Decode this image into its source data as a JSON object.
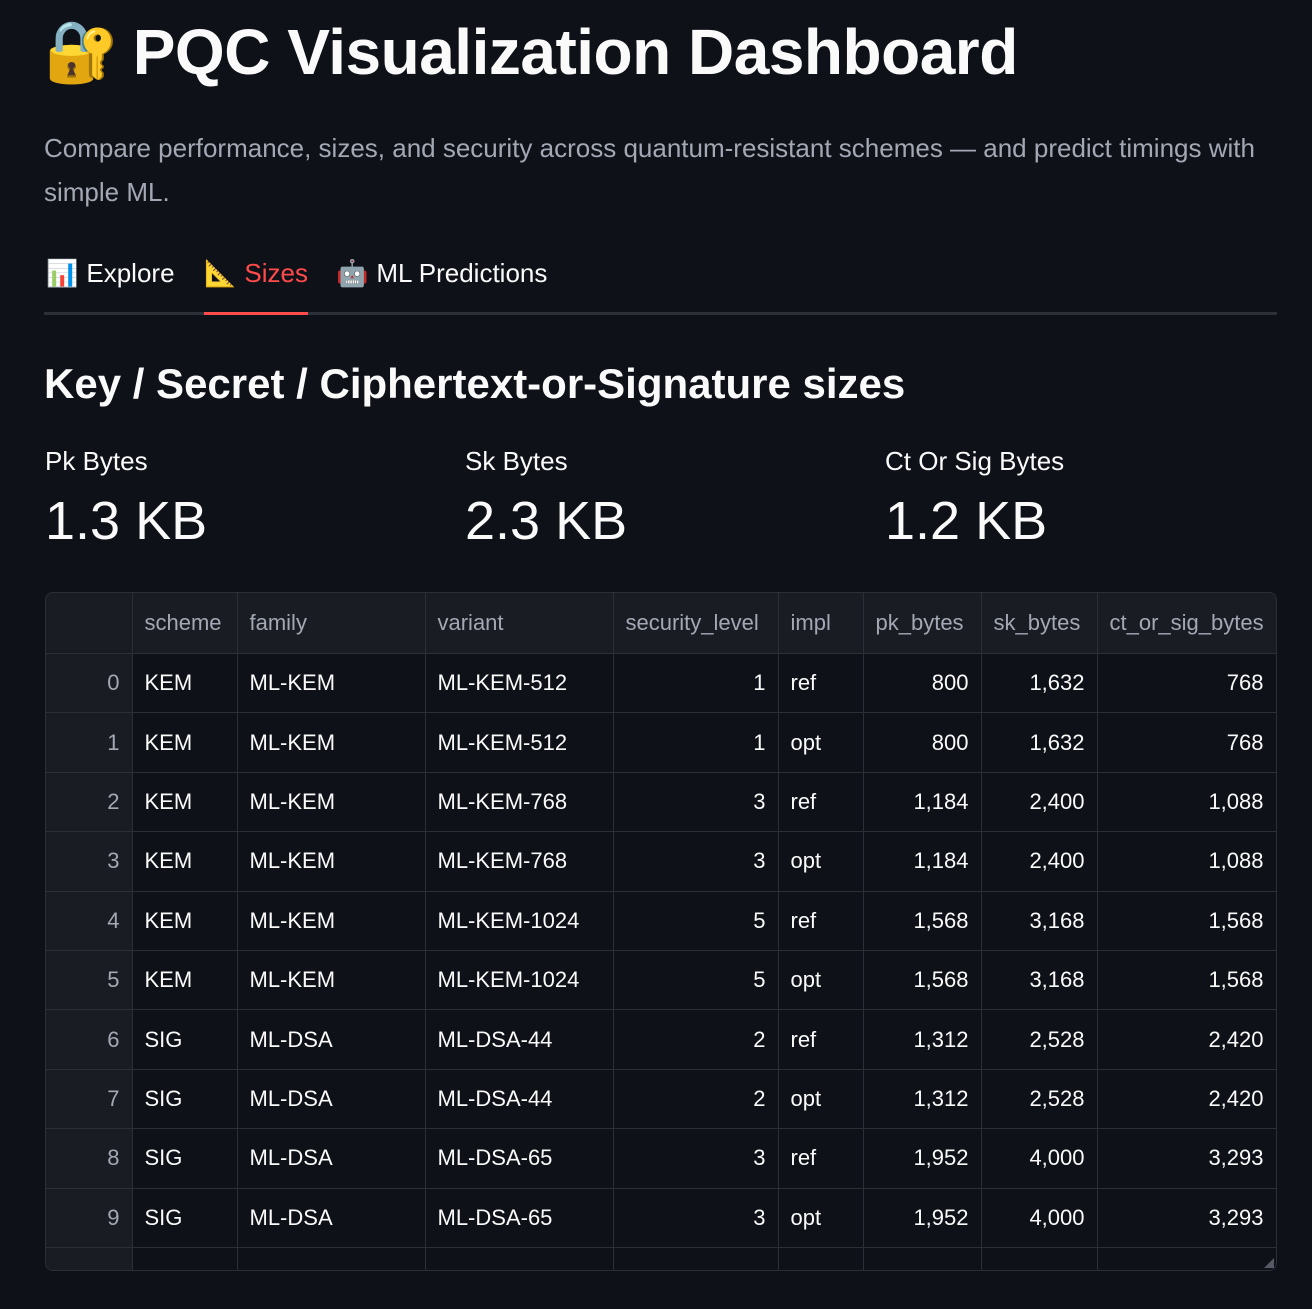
{
  "header": {
    "icon": "🔐",
    "title": "PQC Visualization Dashboard",
    "subtitle": "Compare performance, sizes, and security across quantum-resistant schemes — and predict timings with simple ML."
  },
  "tabs": [
    {
      "icon": "📊",
      "label": "Explore",
      "active": false
    },
    {
      "icon": "📐",
      "label": "Sizes",
      "active": true
    },
    {
      "icon": "🤖",
      "label": "ML Predictions",
      "active": false
    }
  ],
  "section": {
    "title": "Key / Secret / Ciphertext-or-Signature sizes"
  },
  "metrics": [
    {
      "label": "Pk Bytes",
      "value": "1.3 KB"
    },
    {
      "label": "Sk Bytes",
      "value": "2.3 KB"
    },
    {
      "label": "Ct Or Sig Bytes",
      "value": "1.2 KB"
    }
  ],
  "table": {
    "columns": [
      "",
      "scheme",
      "family",
      "variant",
      "security_level",
      "impl",
      "pk_bytes",
      "sk_bytes",
      "ct_or_sig_bytes"
    ],
    "rows": [
      [
        "0",
        "KEM",
        "ML-KEM",
        "ML-KEM-512",
        "1",
        "ref",
        "800",
        "1,632",
        "768"
      ],
      [
        "1",
        "KEM",
        "ML-KEM",
        "ML-KEM-512",
        "1",
        "opt",
        "800",
        "1,632",
        "768"
      ],
      [
        "2",
        "KEM",
        "ML-KEM",
        "ML-KEM-768",
        "3",
        "ref",
        "1,184",
        "2,400",
        "1,088"
      ],
      [
        "3",
        "KEM",
        "ML-KEM",
        "ML-KEM-768",
        "3",
        "opt",
        "1,184",
        "2,400",
        "1,088"
      ],
      [
        "4",
        "KEM",
        "ML-KEM",
        "ML-KEM-1024",
        "5",
        "ref",
        "1,568",
        "3,168",
        "1,568"
      ],
      [
        "5",
        "KEM",
        "ML-KEM",
        "ML-KEM-1024",
        "5",
        "opt",
        "1,568",
        "3,168",
        "1,568"
      ],
      [
        "6",
        "SIG",
        "ML-DSA",
        "ML-DSA-44",
        "2",
        "ref",
        "1,312",
        "2,528",
        "2,420"
      ],
      [
        "7",
        "SIG",
        "ML-DSA",
        "ML-DSA-44",
        "2",
        "opt",
        "1,312",
        "2,528",
        "2,420"
      ],
      [
        "8",
        "SIG",
        "ML-DSA",
        "ML-DSA-65",
        "3",
        "ref",
        "1,952",
        "4,000",
        "3,293"
      ],
      [
        "9",
        "SIG",
        "ML-DSA",
        "ML-DSA-65",
        "3",
        "opt",
        "1,952",
        "4,000",
        "3,293"
      ]
    ]
  }
}
